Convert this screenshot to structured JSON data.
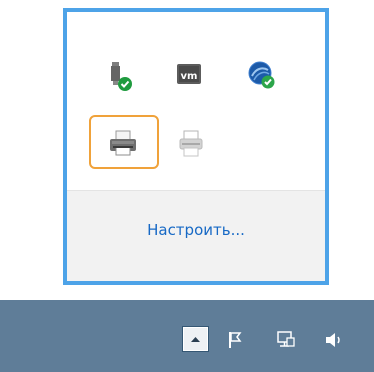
{
  "flyout": {
    "customize_label": "Настроить..."
  },
  "tray_icons": [
    {
      "name": "usb-safely-remove-icon"
    },
    {
      "name": "vmware-vm-icon"
    },
    {
      "name": "network-globe-shield-icon"
    },
    {
      "name": "printer-icon",
      "highlighted": true
    },
    {
      "name": "printer-icon"
    }
  ],
  "taskbar": {
    "show_hidden_icon": "chevron-up-icon",
    "icons": [
      "action-center-flag-icon",
      "network-icon",
      "volume-icon"
    ]
  },
  "colors": {
    "flyout_border": "#4da3e8",
    "highlight": "#f0a23a",
    "link": "#1769c5",
    "taskbar": "#5f7d98"
  }
}
